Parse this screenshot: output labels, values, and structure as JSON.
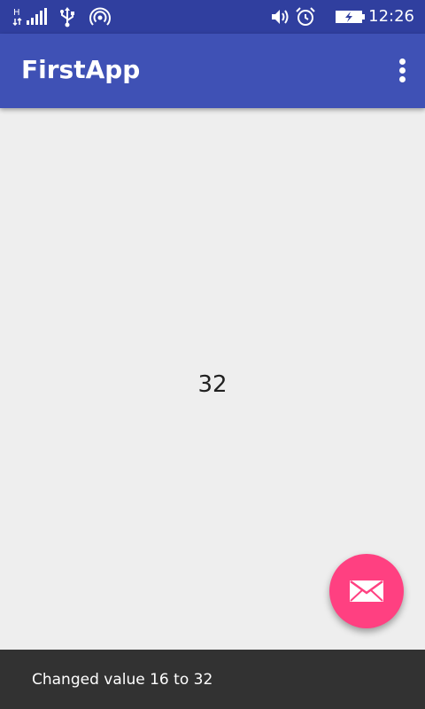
{
  "status_bar": {
    "time": "12:26",
    "icons": [
      "signal-icon",
      "usb-icon",
      "hotspot-icon",
      "volume-icon",
      "alarm-icon",
      "battery-charging-icon"
    ]
  },
  "app_bar": {
    "title": "FirstApp",
    "overflow_icon": "more-vert-icon"
  },
  "main": {
    "value": "32"
  },
  "fab": {
    "icon": "mail-icon"
  },
  "snackbar": {
    "message": "Changed value 16 to 32"
  },
  "colors": {
    "status_bar": "#303f9f",
    "app_bar": "#3f51b5",
    "background": "#eeeeee",
    "fab": "#ff4081",
    "snackbar": "#323232"
  }
}
